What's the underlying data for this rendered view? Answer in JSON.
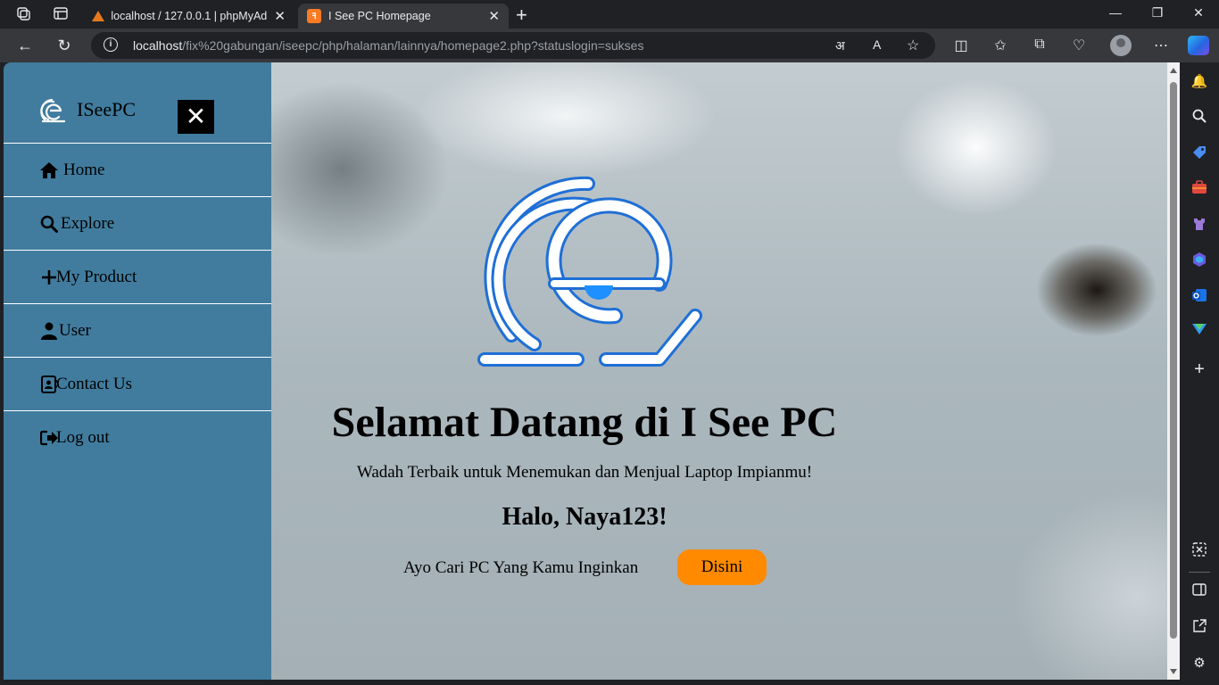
{
  "browser": {
    "tabs": [
      {
        "title": "localhost / 127.0.0.1 | phpMyAdmin",
        "icon": "phpmyadmin-favicon"
      },
      {
        "title": "I See PC Homepage",
        "icon": "xampp-favicon",
        "favicon_text": "ꟻ"
      }
    ],
    "url_host": "localhost",
    "url_path": "/fix%20gabungan/iseepc/php/halaman/lainnya/homepage2.php?statuslogin=sukses"
  },
  "site": {
    "brand": "ISeePC",
    "nav": [
      {
        "label": "Home",
        "icon": "home-icon"
      },
      {
        "label": "Explore",
        "icon": "search-icon"
      },
      {
        "label": "My Product",
        "icon": "plus-icon"
      },
      {
        "label": "User",
        "icon": "user-icon"
      },
      {
        "label": "Contact Us",
        "icon": "contact-book-icon"
      },
      {
        "label": "Log out",
        "icon": "logout-icon"
      }
    ]
  },
  "hero": {
    "title": "Selamat Datang di I See PC",
    "tagline": "Wadah Terbaik untuk Menemukan dan Menjual Laptop Impianmu!",
    "greeting": "Halo, Naya123!",
    "cta_text": "Ayo Cari PC Yang Kamu Inginkan",
    "cta_button": "Disini"
  },
  "colors": {
    "sidebar": "#417c9e",
    "cta": "#ff8a00",
    "logo_stroke": "#1f6fd6"
  }
}
